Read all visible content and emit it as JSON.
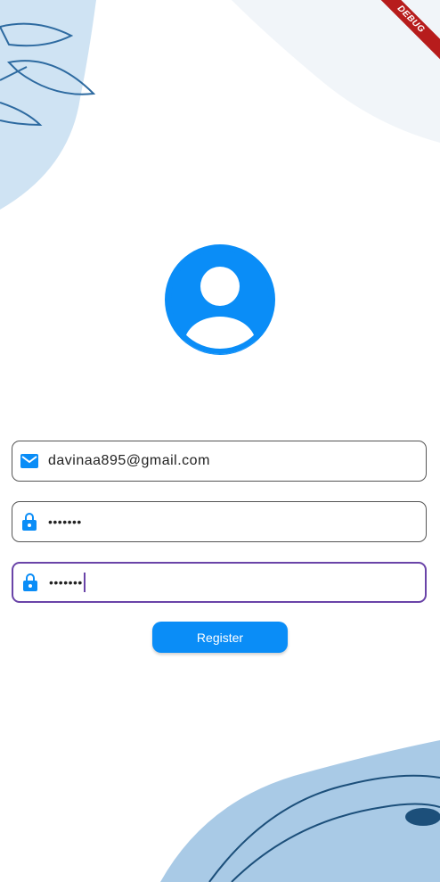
{
  "status": {
    "debug_banner": "DEBUG"
  },
  "form": {
    "email": {
      "value": "davinaa895@gmail.com",
      "icon": "mail-icon"
    },
    "password": {
      "value": "•••••••",
      "icon": "lock-icon"
    },
    "confirm_password": {
      "value": "•••••••",
      "icon": "lock-icon"
    }
  },
  "buttons": {
    "register_label": "Register"
  },
  "colors": {
    "accent": "#0a8df7",
    "focus_border": "#6a44a8",
    "decor_blue": "#a9cae6",
    "decor_lines": "#1c4f7a"
  }
}
